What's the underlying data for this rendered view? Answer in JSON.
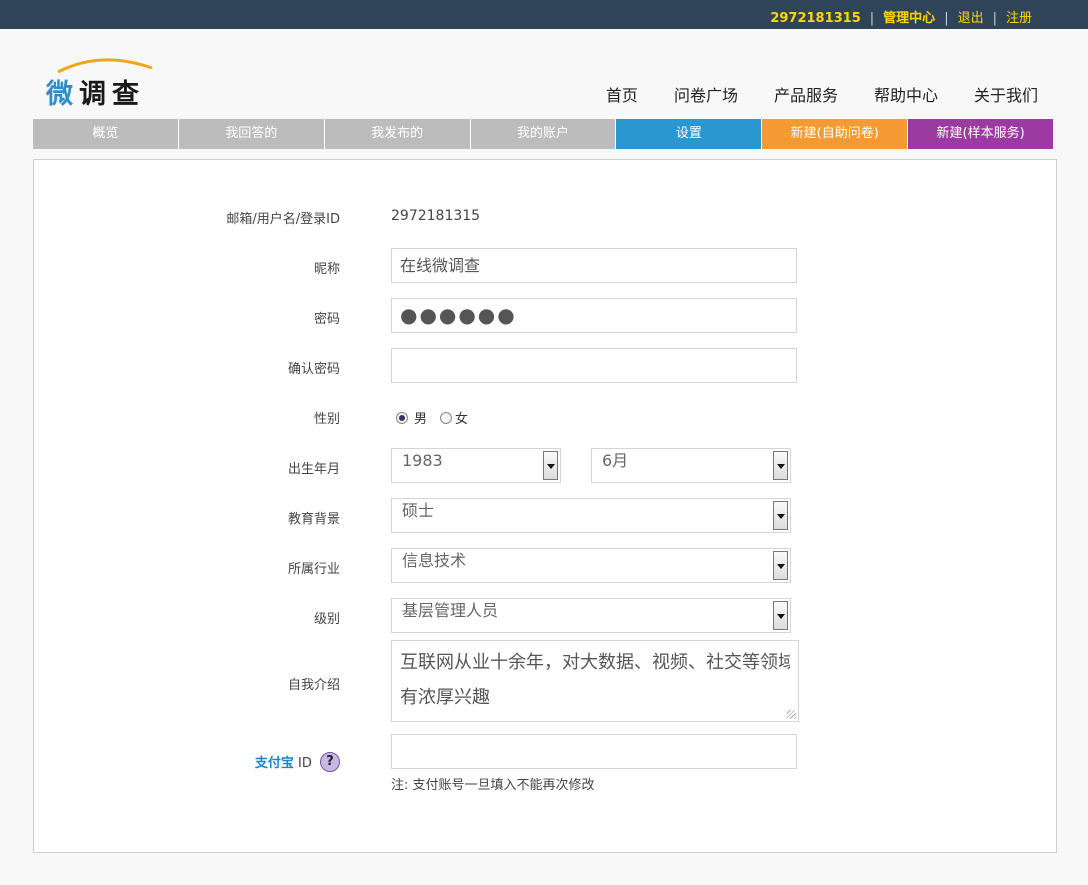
{
  "topbar": {
    "user_id": "2972181315",
    "admin": "管理中心",
    "logout": "退出",
    "register": "注册"
  },
  "logo": {
    "char1": "微",
    "chars_rest": "调查"
  },
  "nav": [
    "首页",
    "问卷广场",
    "产品服务",
    "帮助中心",
    "关于我们"
  ],
  "tabs": [
    "概览",
    "我回答的",
    "我发布的",
    "我的账户",
    "设置",
    "新建(自助问卷)",
    "新建(样本服务)"
  ],
  "form": {
    "login_label": "邮箱/用户名/登录ID",
    "login_value": "2972181315",
    "nickname_label": "昵称",
    "nickname_value": "在线微调查",
    "password_label": "密码",
    "password_value": "●●●●●●",
    "confirm_label": "确认密码",
    "confirm_value": "",
    "gender_label": "性别",
    "gender_male": "男",
    "gender_female": "女",
    "birth_label": "出生年月",
    "birth_year": "1983",
    "birth_month": "6月",
    "education_label": "教育背景",
    "education_value": "硕士",
    "industry_label": "所属行业",
    "industry_value": "信息技术",
    "level_label": "级别",
    "level_value": "基层管理人员",
    "intro_label": "自我介绍",
    "intro_line1": "互联网从业十余年，对大数据、视频、社交等领域",
    "intro_line2": "有浓厚兴趣",
    "alipay_label": "支付宝",
    "alipay_suffix": "ID",
    "alipay_help": "?",
    "alipay_value": "",
    "note": "注: 支付账号一旦填入不能再次修改"
  },
  "colors": {
    "topbar": "#2f4458",
    "active_tab": "#2b97d1",
    "orange_tab": "#f59a32",
    "purple_tab": "#9b3aa0",
    "accent_yellow": "#ffd800",
    "alipay_blue": "#1a86c8"
  }
}
